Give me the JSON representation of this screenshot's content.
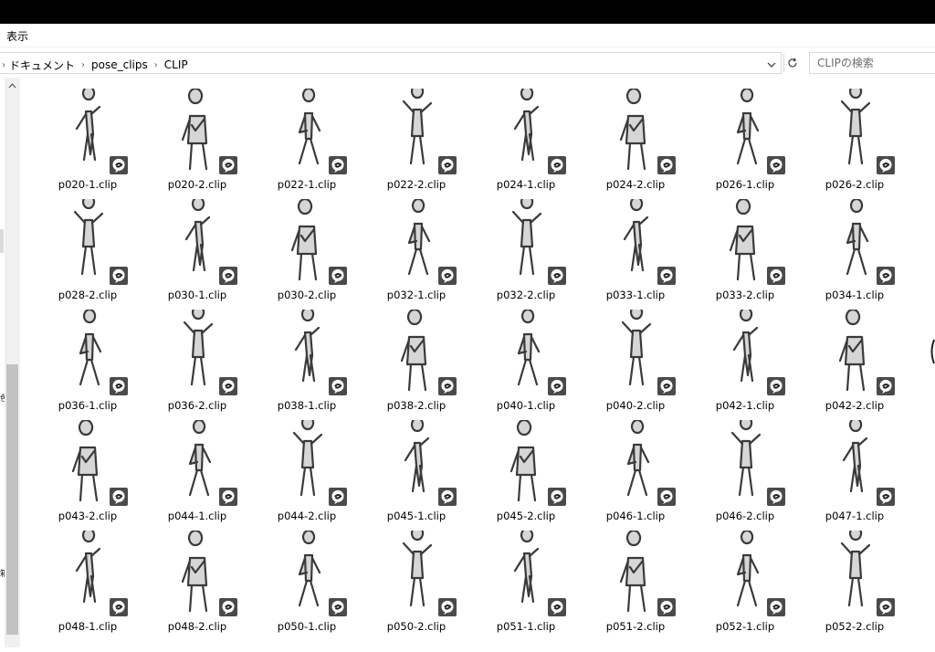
{
  "menu": {
    "view_label": "表示"
  },
  "address": {
    "crumbs": [
      "ドキュメント",
      "pose_clips",
      "CLIP"
    ]
  },
  "search": {
    "placeholder": "CLIPの検索"
  },
  "nav": {
    "label_mid": "色",
    "label_low": "箱"
  },
  "badge_color": "#4a4a4a",
  "files": [
    "p020-1.clip",
    "p020-2.clip",
    "p022-1.clip",
    "p022-2.clip",
    "p024-1.clip",
    "p024-2.clip",
    "p026-1.clip",
    "p026-2.clip",
    "p028-2.clip",
    "p030-1.clip",
    "p030-2.clip",
    "p032-1.clip",
    "p032-2.clip",
    "p033-1.clip",
    "p033-2.clip",
    "p034-1.clip",
    "p036-1.clip",
    "p036-2.clip",
    "p038-1.clip",
    "p038-2.clip",
    "p040-1.clip",
    "p040-2.clip",
    "p042-1.clip",
    "p042-2.clip",
    "p043-2.clip",
    "p044-1.clip",
    "p044-2.clip",
    "p045-1.clip",
    "p045-2.clip",
    "p046-1.clip",
    "p046-2.clip",
    "p047-1.clip",
    "p048-1.clip",
    "p048-2.clip",
    "p050-1.clip",
    "p050-2.clip",
    "p051-1.clip",
    "p051-2.clip",
    "p052-1.clip",
    "p052-2.clip"
  ]
}
